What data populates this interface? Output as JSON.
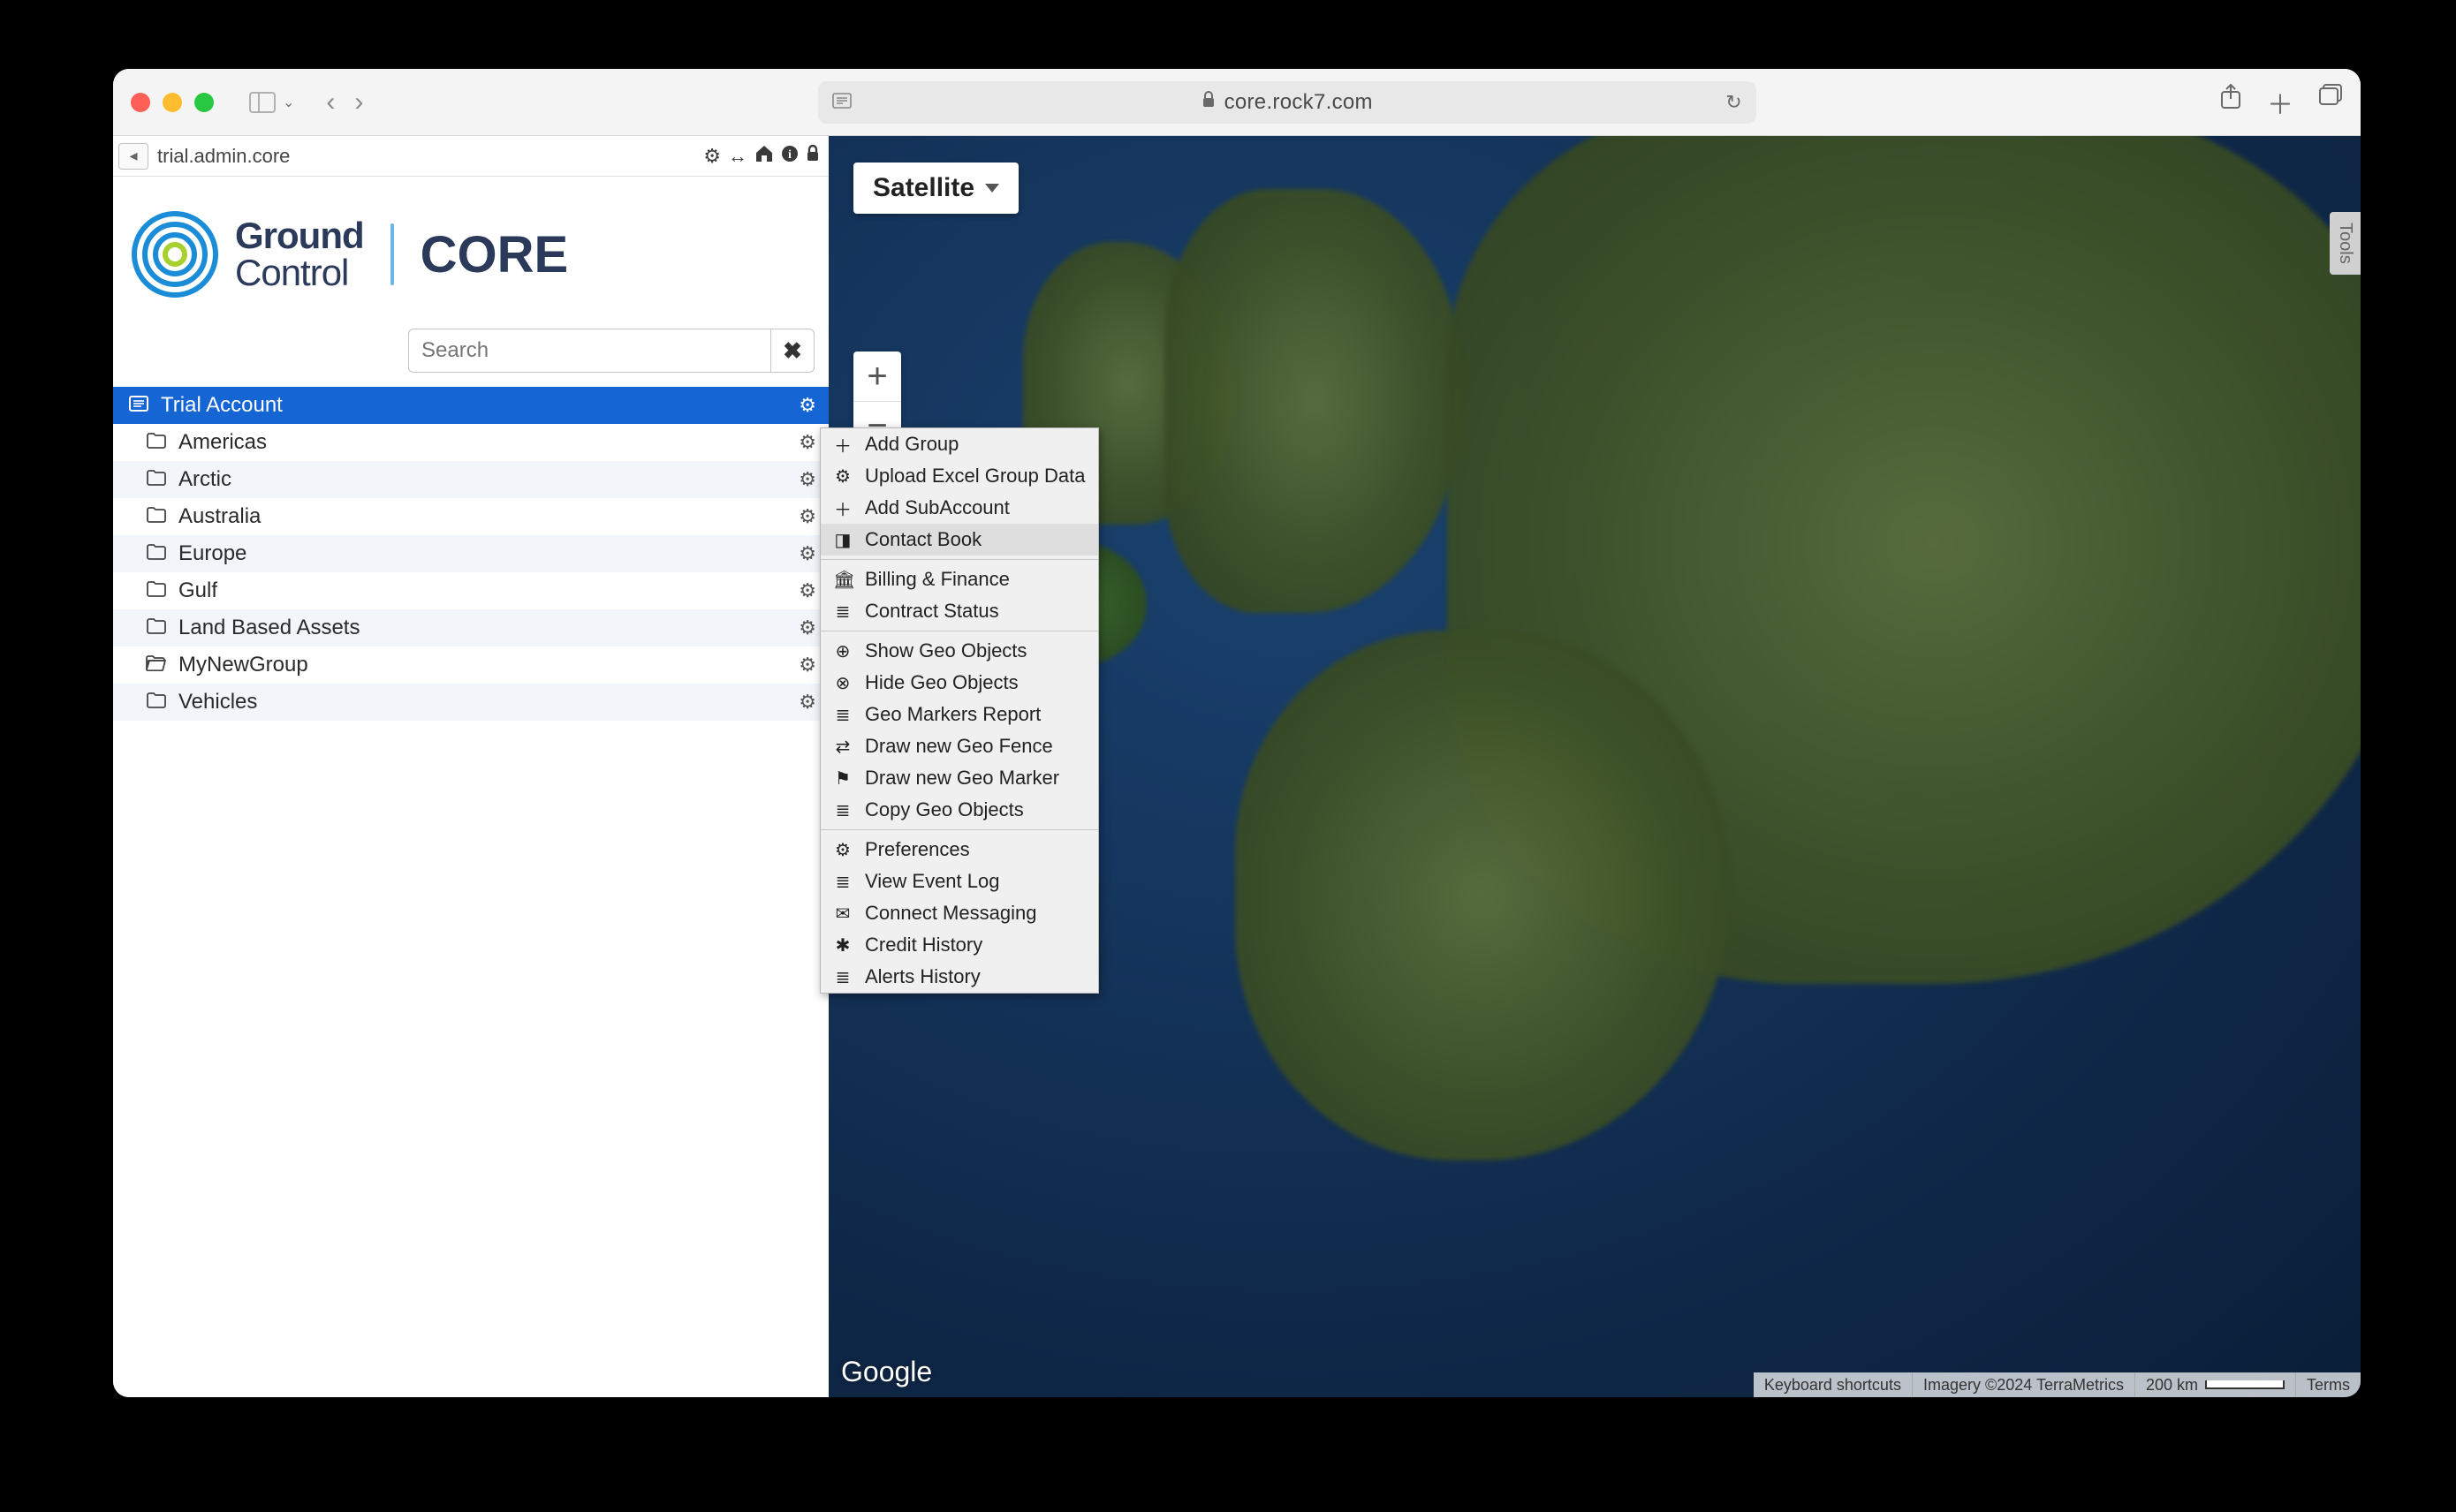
{
  "browser": {
    "url_host": "core.rock7.com"
  },
  "sidebar": {
    "breadcrumb": "trial.admin.core",
    "search": {
      "placeholder": "Search"
    },
    "tree": {
      "account_label": "Trial Account",
      "items": [
        {
          "label": "Americas"
        },
        {
          "label": "Arctic"
        },
        {
          "label": "Australia"
        },
        {
          "label": "Europe"
        },
        {
          "label": "Gulf"
        },
        {
          "label": "Land Based Assets"
        },
        {
          "label": "MyNewGroup"
        },
        {
          "label": "Vehicles"
        }
      ]
    }
  },
  "logo": {
    "ground": "Ground",
    "control": "Control",
    "core": "CORE"
  },
  "map": {
    "type_label": "Satellite",
    "zoom_in": "+",
    "zoom_out": "−",
    "tools_label": "Tools",
    "google_label": "Google",
    "footer": {
      "shortcuts": "Keyboard shortcuts",
      "imagery": "Imagery ©2024 TerraMetrics",
      "scale": "200 km",
      "terms": "Terms"
    }
  },
  "context_menu": {
    "groups": [
      [
        {
          "icon": "plus-icon",
          "label": "Add Group"
        },
        {
          "icon": "gear-icon",
          "label": "Upload Excel Group Data"
        },
        {
          "icon": "plus-icon",
          "label": "Add SubAccount"
        },
        {
          "icon": "book-icon",
          "label": "Contact Book",
          "highlight": true
        }
      ],
      [
        {
          "icon": "bank-icon",
          "label": "Billing & Finance"
        },
        {
          "icon": "list-icon",
          "label": "Contract Status"
        }
      ],
      [
        {
          "icon": "target-icon",
          "label": "Show Geo Objects"
        },
        {
          "icon": "x-circle-icon",
          "label": "Hide Geo Objects"
        },
        {
          "icon": "list-icon",
          "label": "Geo Markers Report"
        },
        {
          "icon": "swap-icon",
          "label": "Draw new Geo Fence"
        },
        {
          "icon": "flag-icon",
          "label": "Draw new Geo Marker"
        },
        {
          "icon": "list-icon",
          "label": "Copy Geo Objects"
        }
      ],
      [
        {
          "icon": "gear-icon",
          "label": "Preferences"
        },
        {
          "icon": "list-icon",
          "label": "View Event Log"
        },
        {
          "icon": "mail-icon",
          "label": "Connect Messaging"
        },
        {
          "icon": "asterisk-icon",
          "label": "Credit History"
        },
        {
          "icon": "list-icon",
          "label": "Alerts History"
        }
      ]
    ]
  }
}
